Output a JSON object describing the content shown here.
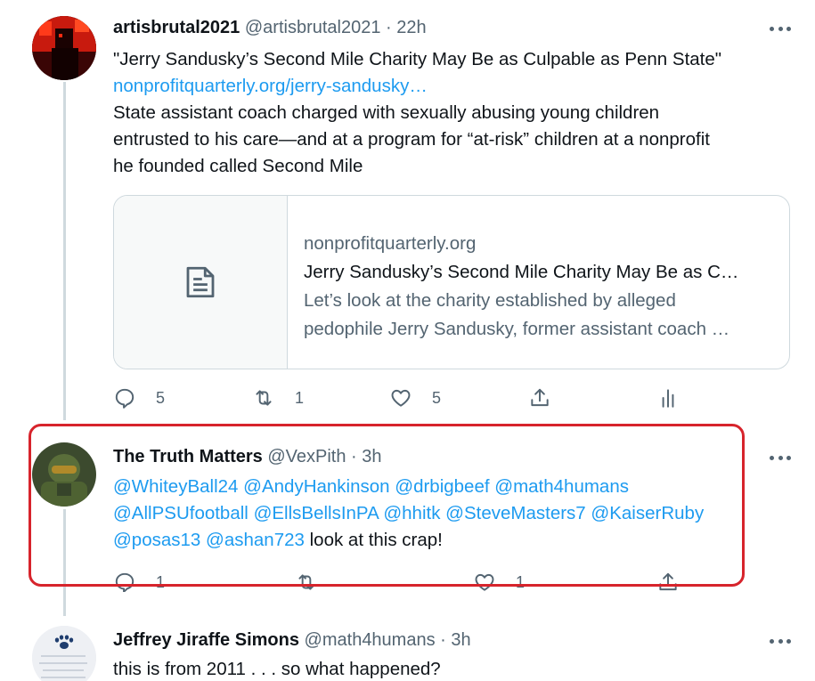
{
  "tweets": [
    {
      "name": "artisbrutal2021",
      "handle": "@artisbrutal2021",
      "separator": "·",
      "time": "22h",
      "lines": [
        "\"Jerry Sandusky’s Second Mile Charity May Be as Culpable as Penn State\"",
        "State assistant coach charged with sexually abusing young children",
        "entrusted to his care—and at a program for “at-risk” children at a nonprofit",
        "he founded called Second Mile"
      ],
      "link": "nonprofitquarterly.org/jerry-sandusky…",
      "card": {
        "domain": "nonprofitquarterly.org",
        "title": "Jerry Sandusky’s Second Mile Charity May Be as C…",
        "description_lines": [
          "Let’s look at the charity established by alleged",
          "pedophile Jerry Sandusky, former assistant coach …"
        ],
        "thumb_icon": "article-icon"
      },
      "actions": {
        "replies": "5",
        "retweets": "1",
        "likes": "5"
      }
    },
    {
      "name": "The Truth Matters",
      "handle": "@VexPith",
      "separator": "·",
      "time": "3h",
      "mentions_line1": [
        "@WhiteyBall24",
        "@AndyHankinson",
        "@drbigbeef",
        "@math4humans"
      ],
      "mentions_line2": [
        "@AllPSUfootball",
        "@EllsBellsInPA",
        "@hhitk",
        "@SteveMasters7",
        "@KaiserRuby"
      ],
      "mentions_line3": [
        "@posas13",
        "@ashan723"
      ],
      "trailing_text": "look at this crap!",
      "actions": {
        "replies": "1",
        "likes": "1"
      }
    },
    {
      "name": "Jeffrey Jiraffe Simons",
      "handle": "@math4humans",
      "separator": "·",
      "time": "3h",
      "text": "this is from 2011 . . . so what happened?"
    }
  ],
  "colors": {
    "link": "#1d9bf0",
    "muted": "#536471",
    "highlight": "#d7242c",
    "thread_line": "#cfd9de"
  }
}
